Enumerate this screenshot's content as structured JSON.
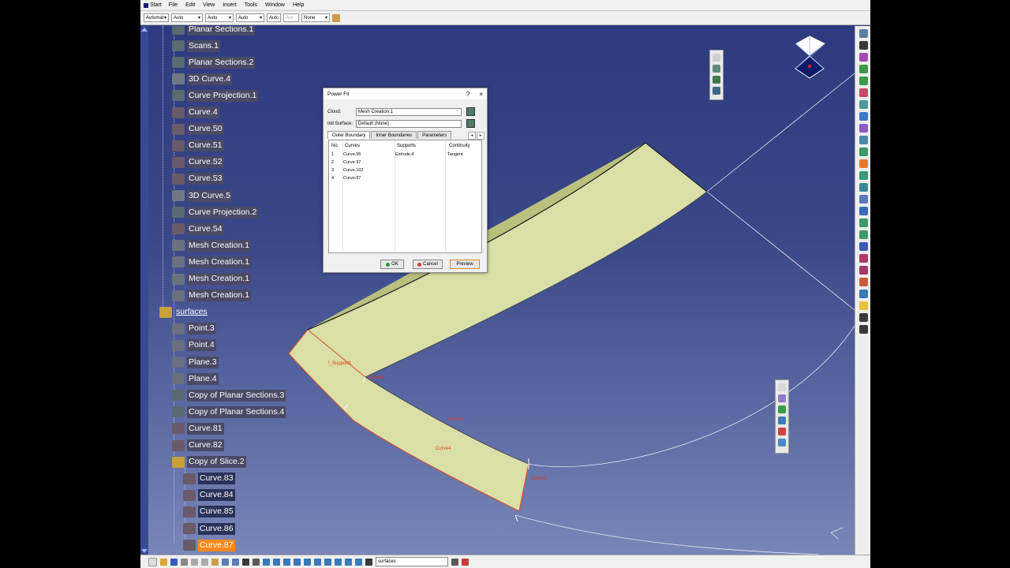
{
  "menubar": {
    "items": [
      "Start",
      "File",
      "Edit",
      "View",
      "Insert",
      "Tools",
      "Window",
      "Help"
    ]
  },
  "toolbar": {
    "combos": [
      "Automat",
      "Auto",
      "Auto",
      "Auto",
      "Autc",
      "Aut",
      "None"
    ]
  },
  "tree": {
    "nodes": [
      {
        "label": "Planar Sections.1",
        "icon": "planar-sections-icon"
      },
      {
        "label": "Scans.1",
        "icon": "scans-icon"
      },
      {
        "label": "Planar Sections.2",
        "icon": "planar-sections-icon"
      },
      {
        "label": "3D Curve.4",
        "icon": "3d-curve-icon"
      },
      {
        "label": "Curve Projection.1",
        "icon": "curve-projection-icon"
      },
      {
        "label": "Curve.4",
        "icon": "curve-icon"
      },
      {
        "label": "Curve.50",
        "icon": "curve-icon"
      },
      {
        "label": "Curve.51",
        "icon": "curve-icon"
      },
      {
        "label": "Curve.52",
        "icon": "curve-icon"
      },
      {
        "label": "Curve.53",
        "icon": "curve-icon"
      },
      {
        "label": "3D Curve.5",
        "icon": "3d-curve-icon"
      },
      {
        "label": "Curve Projection.2",
        "icon": "curve-projection-icon"
      },
      {
        "label": "Curve.54",
        "icon": "curve-icon"
      },
      {
        "label": "Mesh Creation.1",
        "icon": "mesh-icon"
      },
      {
        "label": "Mesh Creation.1",
        "icon": "mesh-icon"
      },
      {
        "label": "Mesh Creation.1",
        "icon": "mesh-icon"
      },
      {
        "label": "Mesh Creation.1",
        "icon": "mesh-icon"
      },
      {
        "label": "surfaces",
        "icon": "geometrical-set-icon"
      },
      {
        "label": "Point.3",
        "icon": "point-icon"
      },
      {
        "label": "Point.4",
        "icon": "point-icon"
      },
      {
        "label": "Plane.3",
        "icon": "plane-icon"
      },
      {
        "label": "Plane.4",
        "icon": "plane-icon"
      },
      {
        "label": "Copy of Planar Sections.3",
        "icon": "planar-sections-icon"
      },
      {
        "label": "Copy of Planar Sections.4",
        "icon": "planar-sections-icon"
      },
      {
        "label": "Curve.81",
        "icon": "curve-icon"
      },
      {
        "label": "Curve.82",
        "icon": "curve-icon"
      },
      {
        "label": "Copy of Slice.2",
        "icon": "geometrical-set-icon"
      },
      {
        "label": "Curve.83",
        "icon": "curve-icon"
      },
      {
        "label": "Curve.84",
        "icon": "curve-icon"
      },
      {
        "label": "Curve.85",
        "icon": "curve-icon"
      },
      {
        "label": "Curve.86",
        "icon": "curve-icon"
      },
      {
        "label": "Curve.87",
        "icon": "curve-icon"
      }
    ]
  },
  "dialog": {
    "title": "Power Fit",
    "help": "?",
    "close": "×",
    "cloud_label": "Cloud:",
    "cloud_value": "Mesh Creation.1",
    "init_label": "Init Surface:",
    "init_value": "Default (None)",
    "tabs": [
      "Outer Boundary",
      "Inner Boundaries",
      "Parameters"
    ],
    "columns": [
      "No.",
      "Curves",
      "Supports",
      "Continuity"
    ],
    "rows": [
      {
        "no": "1",
        "curve": "Curve.95",
        "support": "Extrude.4",
        "continuity": "Tangent"
      },
      {
        "no": "2",
        "curve": "Curve.97",
        "support": "",
        "continuity": ""
      },
      {
        "no": "3",
        "curve": "Curve.102",
        "support": "",
        "continuity": ""
      },
      {
        "no": "4",
        "curve": "Curve.87",
        "support": "",
        "continuity": ""
      }
    ],
    "ok": "OK",
    "cancel": "Cancel",
    "preview": "Preview"
  },
  "viewport": {
    "labels": {
      "support": "\\_Support1",
      "curve1": "Curve1",
      "curve2": "Curve2",
      "curve3": "Curve3",
      "curve4": "Curve4"
    },
    "compass": "compass-icon"
  },
  "bottombar": {
    "combo_value": "surfaces"
  },
  "colors": {
    "background": "#2f3a7e",
    "surface": "#d9dfa6",
    "selection": "#ff8a1a",
    "boundary": "#e0502a"
  }
}
